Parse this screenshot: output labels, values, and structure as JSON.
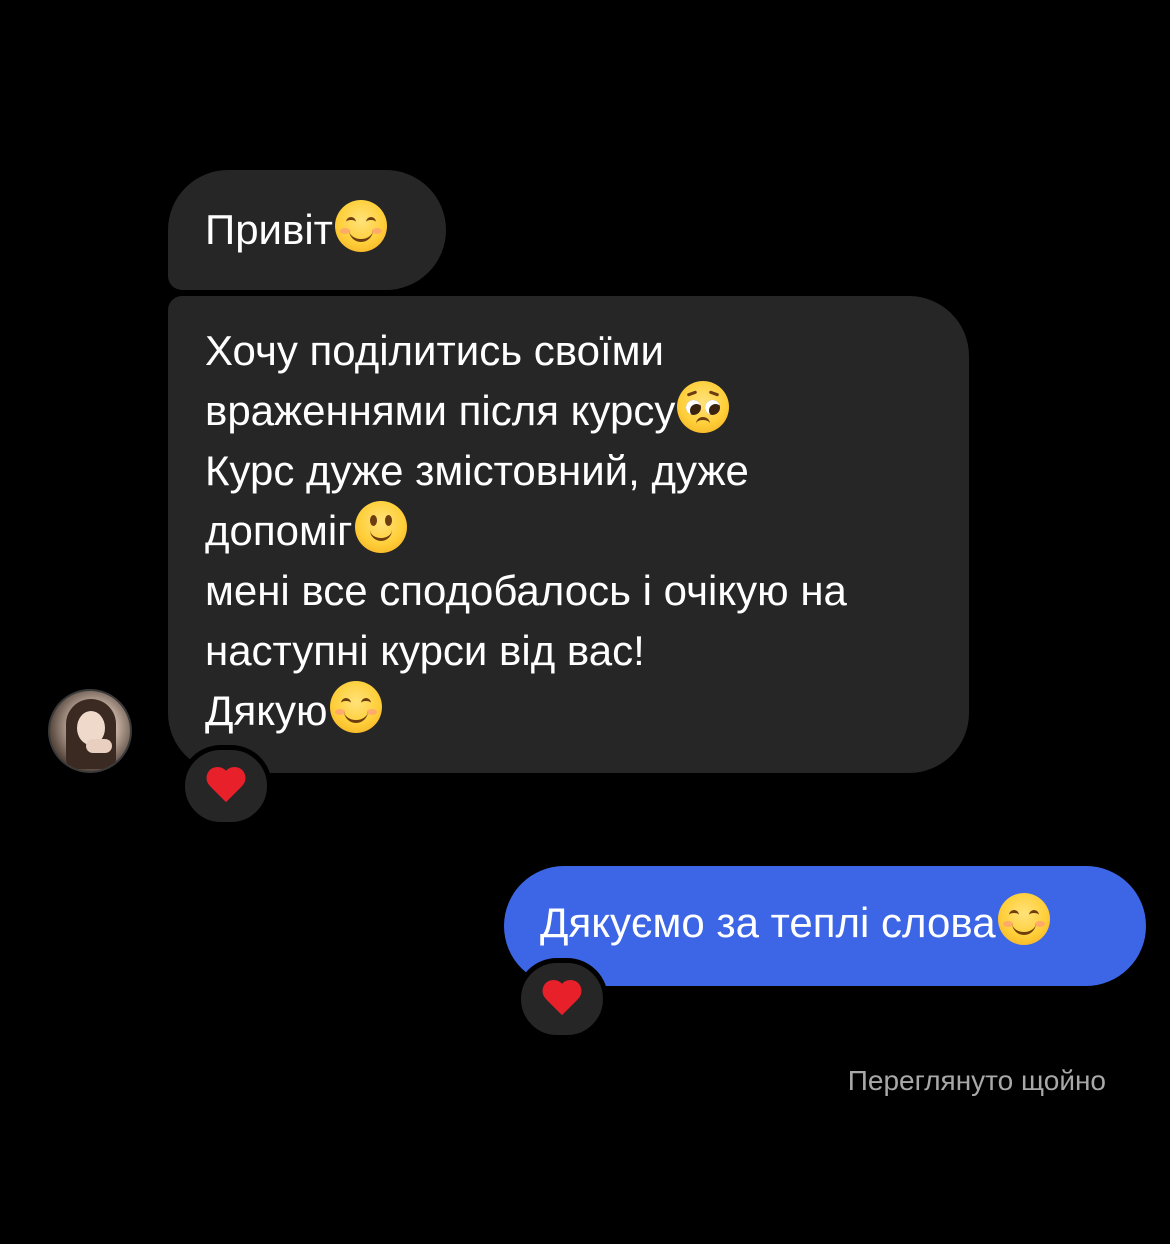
{
  "conversation": {
    "messages": [
      {
        "direction": "incoming",
        "lines": [
          "Привіт"
        ],
        "emoji": "smiling-face-with-smiling-eyes"
      },
      {
        "direction": "incoming",
        "lines": [
          "Хочу поділитись своїми",
          "враженнями після курсу",
          "Курс дуже змістовний, дуже",
          "допоміг",
          "мені все сподобалось і очікую на",
          "наступні курси від вас!",
          "Дякую"
        ],
        "emojis": [
          "pleading-face",
          "slightly-smiling-face",
          "smiling-face-with-smiling-eyes"
        ],
        "reaction": "red-heart"
      },
      {
        "direction": "outgoing",
        "lines": [
          "Дякуємо за теплі слова"
        ],
        "emoji": "smiling-face-with-smiling-eyes",
        "reaction": "red-heart"
      }
    ],
    "seen_status": "Переглянуто щойно"
  },
  "colors": {
    "background": "#000000",
    "incoming_bubble": "#262626",
    "outgoing_bubble": "#3c66e6",
    "status_text": "#a8a8a8",
    "heart": "#e8202a"
  }
}
